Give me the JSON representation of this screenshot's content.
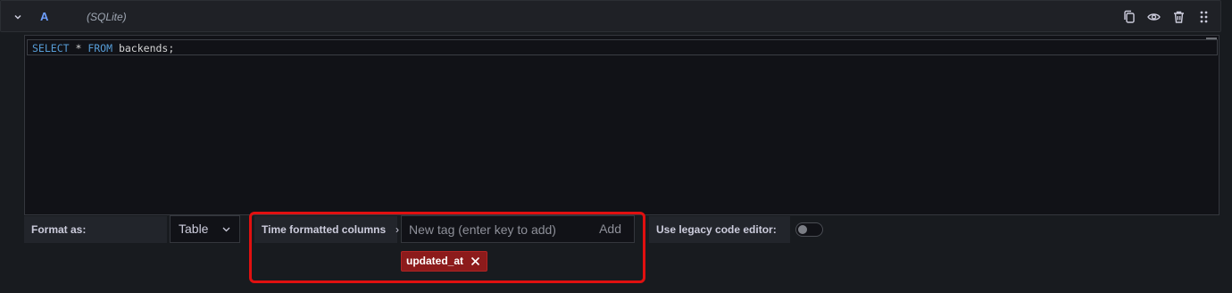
{
  "query": {
    "ref_id": "A",
    "datasource": "(SQLite)",
    "icons": [
      "chevron-down-icon",
      "copy-icon",
      "eye-icon",
      "trash-icon",
      "drag-handle-icon"
    ]
  },
  "editor": {
    "kw1": "SELECT",
    "op": " * ",
    "kw2": "FROM",
    "rest": " backends;"
  },
  "options": {
    "format_label": "Format as:",
    "format_value": "Table",
    "time_cols_label": "Time formatted columns",
    "tag_input_placeholder": "New tag (enter key to add)",
    "add_label": "Add",
    "tags": [
      "updated_at"
    ],
    "legacy_label": "Use legacy code editor:",
    "legacy_enabled": false
  },
  "colors": {
    "highlight_border": "#e01010",
    "tag_bg": "#8c1b1b",
    "ref_id": "#6e9fff"
  }
}
